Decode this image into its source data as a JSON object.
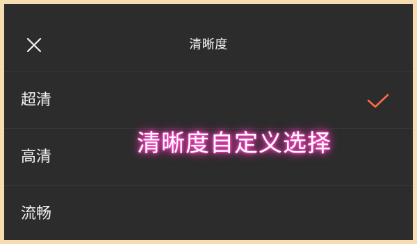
{
  "header": {
    "title": "清晰度",
    "close_icon": "close-icon"
  },
  "quality_options": [
    {
      "label": "超清",
      "selected": true
    },
    {
      "label": "高清",
      "selected": false
    },
    {
      "label": "流畅",
      "selected": false
    }
  ],
  "overlay": {
    "text": "清晰度自定义选择"
  },
  "colors": {
    "background": "#2c2c2c",
    "border": "#f6ddb1",
    "accent": "#ff6b4a",
    "glow": "#ff39b8"
  },
  "icons": {
    "selected": "checkmark-icon"
  }
}
